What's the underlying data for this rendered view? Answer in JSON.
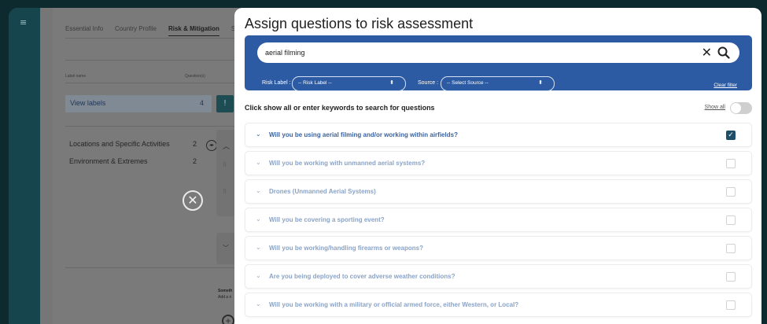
{
  "nav": {
    "menu_icon": "≡"
  },
  "background_page": {
    "tabs": [
      "Essential Info",
      "Country Profile",
      "Risk & Mitigation",
      "S"
    ],
    "active_tab_index": 2,
    "columns": {
      "label": "Label name",
      "questions": "Question(s)"
    },
    "view_labels": {
      "label": "View labels",
      "count": "4"
    },
    "groups": [
      {
        "label": "Locations and Specific Activities",
        "count": "2"
      },
      {
        "label": "Environment & Extremes",
        "count": "2"
      }
    ],
    "bottom_text": [
      "Someth",
      "Add a n"
    ]
  },
  "modal": {
    "title": "Assign questions to risk assessment",
    "search": {
      "value": "aerial filming",
      "clear_symbol": "✕"
    },
    "filters": {
      "risk_label": {
        "label": "Risk Label :",
        "selected": "-- Risk Label --"
      },
      "source": {
        "label": "Source :",
        "selected": "-- Select Source --"
      },
      "clear": "Clear filter"
    },
    "hint": "Click show all or enter keywords to search for questions",
    "show_all": {
      "label": "Show all",
      "on": false
    },
    "questions": [
      {
        "text": "Will you be using aerial filming and/or working within airfields?",
        "checked": true
      },
      {
        "text": "Will you be working with unmanned aerial systems?",
        "checked": false
      },
      {
        "text": "Drones (Unmanned Aerial Systems)",
        "checked": false
      },
      {
        "text": "Will you be covering a sporting event?",
        "checked": false
      },
      {
        "text": "Will you be working/handling firearms or weapons?",
        "checked": false
      },
      {
        "text": "Are you being deployed to cover adverse weather conditions?",
        "checked": false
      },
      {
        "text": "Will you be working with a military or official armed force, either Western, or Local?",
        "checked": false
      }
    ]
  },
  "colors": {
    "accent": "#2d5ba3",
    "frame": "#16454d",
    "checked": "#1f4e68"
  }
}
